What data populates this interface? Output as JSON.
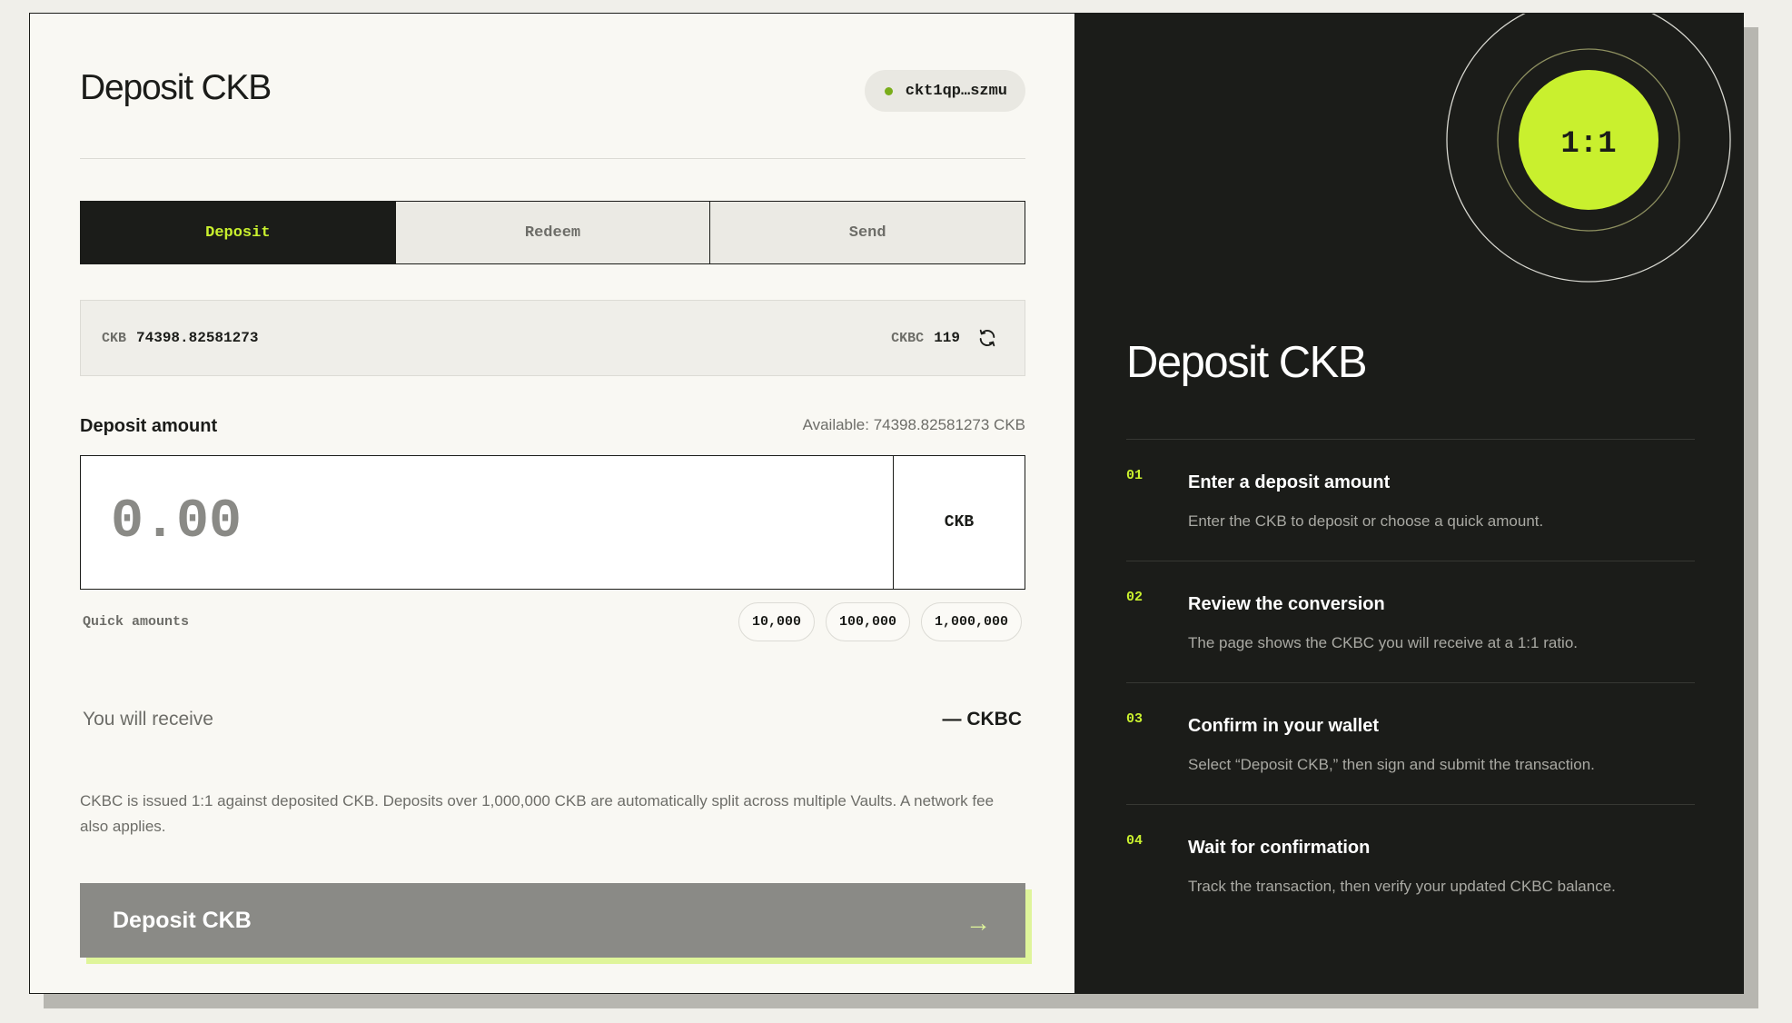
{
  "colors": {
    "accent": "#c9f02e",
    "dark": "#1b1c19",
    "panel_light": "#f9f8f3",
    "status_connected": "#79ad1a",
    "muted_text": "#6d6d68",
    "disabled_button": "#8a8a86"
  },
  "header": {
    "title": "Deposit CKB",
    "wallet_address": "ckt1qp…szmu"
  },
  "tabs": [
    {
      "label": "Deposit",
      "active": true
    },
    {
      "label": "Redeem",
      "active": false
    },
    {
      "label": "Send",
      "active": false
    }
  ],
  "balances": {
    "ckb_label": "CKB",
    "ckb_value": "74398.82581273",
    "ckbc_label": "CKBC",
    "ckbc_value": "119",
    "refresh_icon": "refresh-icon"
  },
  "amount": {
    "label": "Deposit amount",
    "available": "Available: 74398.82581273 CKB",
    "value": "",
    "placeholder": "0.00",
    "unit": "CKB"
  },
  "quick_amounts": {
    "label": "Quick amounts",
    "options": [
      "10,000",
      "100,000",
      "1,000,000"
    ]
  },
  "receive": {
    "label": "You will receive",
    "value": "— CKBC"
  },
  "note": "CKBC is issued 1:1 against deposited CKB. Deposits over 1,000,000 CKB are automatically split across multiple Vaults. A network fee also applies.",
  "submit": {
    "label": "Deposit CKB",
    "arrow": "→"
  },
  "info_panel": {
    "ratio": "1:1",
    "title": "Deposit CKB",
    "steps": [
      {
        "num": "01",
        "title": "Enter a deposit amount",
        "desc": "Enter the CKB to deposit or choose a quick amount."
      },
      {
        "num": "02",
        "title": "Review the conversion",
        "desc": "The page shows the CKBC you will receive at a 1:1 ratio."
      },
      {
        "num": "03",
        "title": "Confirm in your wallet",
        "desc": "Select “Deposit CKB,” then sign and submit the transaction."
      },
      {
        "num": "04",
        "title": "Wait for confirmation",
        "desc": "Track the transaction, then verify your updated CKBC balance."
      }
    ]
  }
}
